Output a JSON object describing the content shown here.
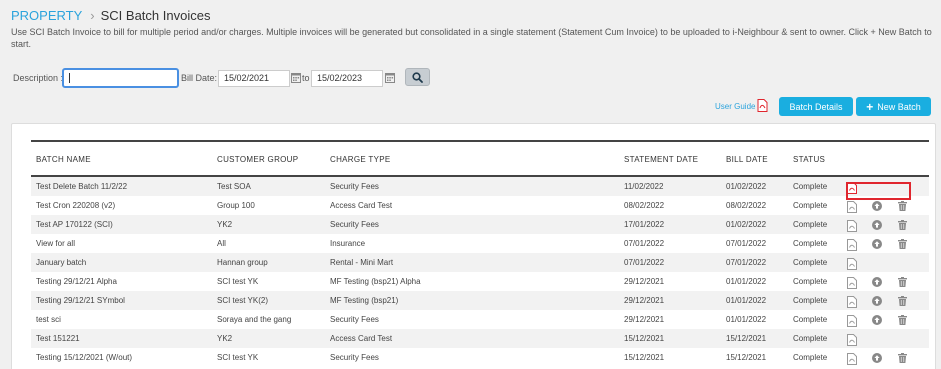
{
  "breadcrumb": {
    "root": "PROPERTY",
    "separator": "›",
    "page": "SCI Batch Invoices"
  },
  "description": "Use SCI Batch Invoice to bill for multiple period and/or charges. Multiple invoices will be generated but consolidated in a single statement (Statement Cum Invoice) to be uploaded to i-Neighbour & sent to owner. Click + New Batch to start.",
  "filters": {
    "description_label": "Description :",
    "description_value": "",
    "bill_date_label": "Bill Date:",
    "date_from": "15/02/2021",
    "to_label": "to",
    "date_to": "15/02/2023"
  },
  "actions": {
    "user_guide": "User Guide",
    "batch_details": "Batch Details",
    "new_batch": "New Batch"
  },
  "table": {
    "headers": [
      "BATCH NAME",
      "CUSTOMER GROUP",
      "CHARGE TYPE",
      "STATEMENT DATE",
      "BILL DATE",
      "STATUS"
    ],
    "rows": [
      {
        "name": "Test Delete Batch 11/2/22",
        "group": "Test SOA",
        "charge": "Security Fees",
        "stmt": "11/02/2022",
        "bill": "01/02/2022",
        "status": "Complete"
      },
      {
        "name": "Test Cron 220208 (v2)",
        "group": "Group 100",
        "charge": "Access Card Test",
        "stmt": "08/02/2022",
        "bill": "08/02/2022",
        "status": "Complete"
      },
      {
        "name": "Test AP 170122 (SCI)",
        "group": "YK2",
        "charge": "Security Fees",
        "stmt": "17/01/2022",
        "bill": "01/02/2022",
        "status": "Complete"
      },
      {
        "name": "View for all",
        "group": "All",
        "charge": "Insurance",
        "stmt": "07/01/2022",
        "bill": "07/01/2022",
        "status": "Complete"
      },
      {
        "name": "January batch",
        "group": "Hannan group",
        "charge": "Rental - Mini Mart",
        "stmt": "07/01/2022",
        "bill": "07/01/2022",
        "status": "Complete"
      },
      {
        "name": "Testing 29/12/21 Alpha",
        "group": "SCI test YK",
        "charge": "MF Testing (bsp21) Alpha",
        "stmt": "29/12/2021",
        "bill": "01/01/2022",
        "status": "Complete"
      },
      {
        "name": "Testing 29/12/21 SYmbol",
        "group": "SCI test YK(2)",
        "charge": "MF Testing (bsp21)",
        "stmt": "29/12/2021",
        "bill": "01/01/2022",
        "status": "Complete"
      },
      {
        "name": "test sci",
        "group": "Soraya and the gang",
        "charge": "Security Fees",
        "stmt": "29/12/2021",
        "bill": "01/01/2022",
        "status": "Complete"
      },
      {
        "name": "Test 151221",
        "group": "YK2",
        "charge": "Access Card Test",
        "stmt": "15/12/2021",
        "bill": "15/12/2021",
        "status": "Complete"
      },
      {
        "name": "Testing 15/12/2021 (W/out)",
        "group": "SCI test YK",
        "charge": "Security Fees",
        "stmt": "15/12/2021",
        "bill": "15/12/2021",
        "status": "Complete"
      }
    ]
  },
  "colors": {
    "accent": "#1aaee0",
    "link": "#2ba3dc",
    "highlight": "#e0262e",
    "pdf_red": "#e0262e"
  }
}
